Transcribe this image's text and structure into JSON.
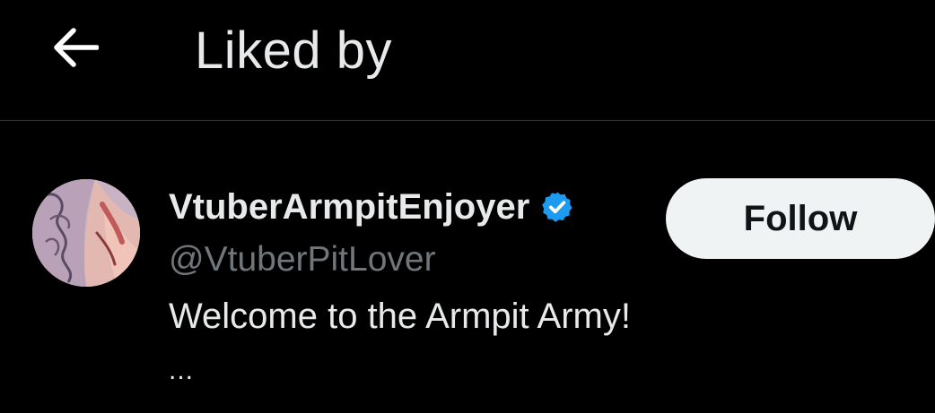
{
  "header": {
    "back_icon": "arrow-left-icon",
    "title": "Liked by"
  },
  "user": {
    "display_name": "VtuberArmpitEnjoyer",
    "verified_icon": "verified-badge-icon",
    "handle": "@VtuberPitLover",
    "bio": "Welcome to the Armpit Army!",
    "bio_more": "...",
    "follow_label": "Follow"
  },
  "colors": {
    "background": "#000000",
    "text_primary": "#e7e9ea",
    "text_secondary": "#71767b",
    "verified_blue": "#1d9bf0",
    "button_bg": "#eff3f4",
    "divider": "#2f3336"
  }
}
